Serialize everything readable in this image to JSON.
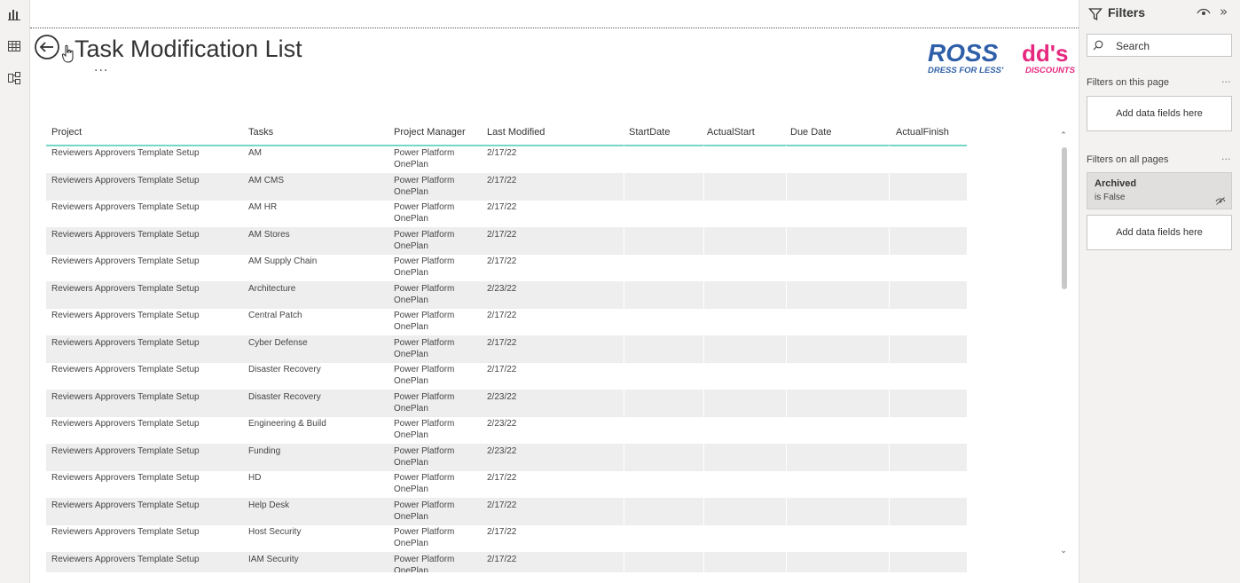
{
  "report": {
    "title": "Task Modification List",
    "more_label": "···",
    "logo": {
      "brand1": "ROSS",
      "brand1_sub": "DRESS FOR LESS'",
      "brand2": "dd's",
      "brand2_sub": "DISCOUNTS"
    }
  },
  "left_rail": {
    "items": [
      {
        "icon": "report-view-icon"
      },
      {
        "icon": "table-view-icon"
      },
      {
        "icon": "model-view-icon"
      }
    ]
  },
  "table": {
    "columns": [
      "Project",
      "Tasks",
      "Project Manager",
      "Last Modified",
      "StartDate",
      "ActualStart",
      "Due Date",
      "ActualFinish"
    ],
    "rows": [
      {
        "project": "Reviewers Approvers Template Setup",
        "task": "AM",
        "pm1": "Power Platform",
        "pm2": "OnePlan",
        "modified": "2/17/22"
      },
      {
        "project": "Reviewers Approvers Template Setup",
        "task": "AM CMS",
        "pm1": "Power Platform",
        "pm2": "OnePlan",
        "modified": "2/17/22"
      },
      {
        "project": "Reviewers Approvers Template Setup",
        "task": "AM HR",
        "pm1": "Power Platform",
        "pm2": "OnePlan",
        "modified": "2/17/22"
      },
      {
        "project": "Reviewers Approvers Template Setup",
        "task": "AM Stores",
        "pm1": "Power Platform",
        "pm2": "OnePlan",
        "modified": "2/17/22"
      },
      {
        "project": "Reviewers Approvers Template Setup",
        "task": "AM Supply Chain",
        "pm1": "Power Platform",
        "pm2": "OnePlan",
        "modified": "2/17/22"
      },
      {
        "project": "Reviewers Approvers Template Setup",
        "task": "Architecture",
        "pm1": "Power Platform",
        "pm2": "OnePlan",
        "modified": "2/23/22"
      },
      {
        "project": "Reviewers Approvers Template Setup",
        "task": "Central Patch",
        "pm1": "Power Platform",
        "pm2": "OnePlan",
        "modified": "2/17/22"
      },
      {
        "project": "Reviewers Approvers Template Setup",
        "task": "Cyber Defense",
        "pm1": "Power Platform",
        "pm2": "OnePlan",
        "modified": "2/17/22"
      },
      {
        "project": "Reviewers Approvers Template Setup",
        "task": "Disaster Recovery",
        "pm1": "Power Platform",
        "pm2": "OnePlan",
        "modified": "2/17/22"
      },
      {
        "project": "Reviewers Approvers Template Setup",
        "task": "Disaster Recovery",
        "pm1": "Power Platform",
        "pm2": "OnePlan",
        "modified": "2/23/22"
      },
      {
        "project": "Reviewers Approvers Template Setup",
        "task": "Engineering & Build",
        "pm1": "Power Platform",
        "pm2": "OnePlan",
        "modified": "2/23/22"
      },
      {
        "project": "Reviewers Approvers Template Setup",
        "task": "Funding",
        "pm1": "Power Platform",
        "pm2": "OnePlan",
        "modified": "2/23/22"
      },
      {
        "project": "Reviewers Approvers Template Setup",
        "task": "HD",
        "pm1": "Power Platform",
        "pm2": "OnePlan",
        "modified": "2/17/22"
      },
      {
        "project": "Reviewers Approvers Template Setup",
        "task": "Help Desk",
        "pm1": "Power Platform",
        "pm2": "OnePlan",
        "modified": "2/17/22"
      },
      {
        "project": "Reviewers Approvers Template Setup",
        "task": "Host Security",
        "pm1": "Power Platform",
        "pm2": "OnePlan",
        "modified": "2/17/22"
      },
      {
        "project": "Reviewers Approvers Template Setup",
        "task": "IAM Security",
        "pm1": "Power Platform",
        "pm2": "OnePlan",
        "modified": "2/17/22"
      }
    ]
  },
  "filters": {
    "title": "Filters",
    "search_placeholder": "Search",
    "on_this_page": "Filters on this page",
    "on_all_pages": "Filters on all pages",
    "add_fields": "Add data fields here",
    "add_fields_2": "Add data fields here",
    "section_more": "···",
    "applied": {
      "field": "Archived",
      "value": "is False"
    }
  }
}
